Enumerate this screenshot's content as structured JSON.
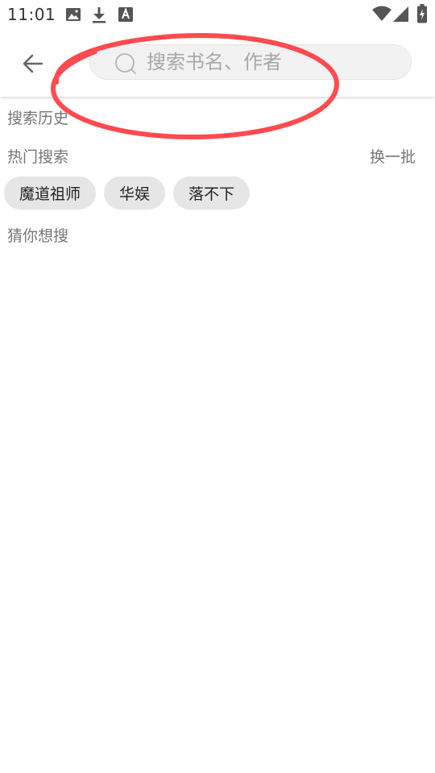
{
  "status_bar": {
    "time": "11:01",
    "icons": [
      "image-icon",
      "download-icon",
      "font-icon",
      "wifi-icon",
      "signal-icon",
      "battery-charging-icon"
    ]
  },
  "toolbar": {
    "back_icon": "arrow-left-icon",
    "search": {
      "placeholder": "搜索书名、作者",
      "value": "",
      "icon": "search-icon"
    },
    "highlight_color": "#ff4a4f"
  },
  "sections": {
    "history_label": "搜索历史",
    "hot_label": "热门搜索",
    "refresh_label": "换一批",
    "hot_tags": [
      "魔道祖师",
      "华娱",
      "落不下"
    ],
    "guess_label": "猜你想搜"
  }
}
